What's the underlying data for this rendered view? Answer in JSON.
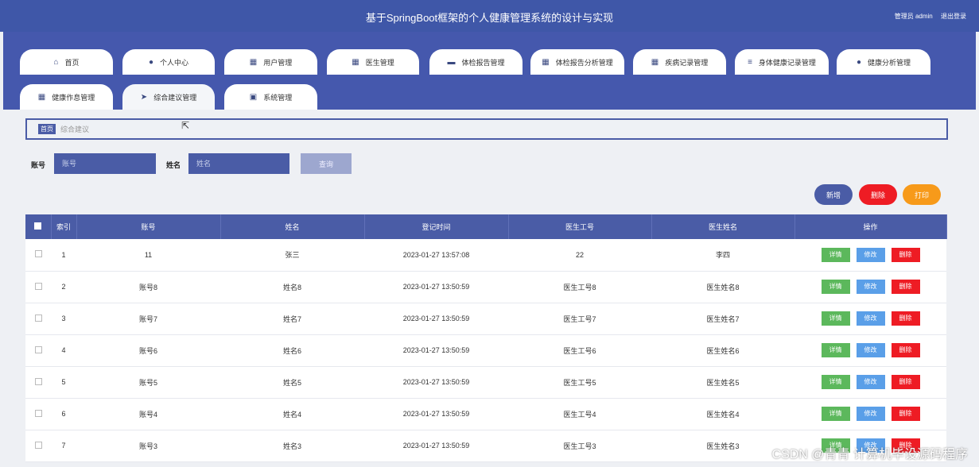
{
  "header": {
    "title": "基于SpringBoot框架的个人健康管理系统的设计与实现",
    "user_label": "管理员 admin",
    "logout_label": "退出登录"
  },
  "nav": {
    "tabs": [
      {
        "label": "首页",
        "icon": "home-icon",
        "glyph": "⌂"
      },
      {
        "label": "个人中心",
        "icon": "user-icon",
        "glyph": "●"
      },
      {
        "label": "用户管理",
        "icon": "grid-icon",
        "glyph": "▦"
      },
      {
        "label": "医生管理",
        "icon": "grid-icon",
        "glyph": "▦"
      },
      {
        "label": "体检报告管理",
        "icon": "briefcase-icon",
        "glyph": "▬"
      },
      {
        "label": "体检报告分析管理",
        "icon": "grid-icon",
        "glyph": "▦"
      },
      {
        "label": "疾病记录管理",
        "icon": "grid-icon",
        "glyph": "▦"
      },
      {
        "label": "身体健康记录管理",
        "icon": "list-icon",
        "glyph": "≡"
      },
      {
        "label": "健康分析管理",
        "icon": "user-icon",
        "glyph": "●"
      },
      {
        "label": "健康作息管理",
        "icon": "grid-icon",
        "glyph": "▦"
      },
      {
        "label": "综合建议管理",
        "icon": "send-icon",
        "glyph": "➤"
      },
      {
        "label": "系统管理",
        "icon": "clipboard-icon",
        "glyph": "▣"
      }
    ]
  },
  "breadcrumb": {
    "home": "首页",
    "current": "综合建议"
  },
  "search": {
    "account_label": "账号",
    "account_placeholder": "账号",
    "name_label": "姓名",
    "name_placeholder": "姓名",
    "query_label": "查询"
  },
  "actions": {
    "add": "新增",
    "delete": "删除",
    "print": "打印"
  },
  "table": {
    "headers": [
      "索引",
      "账号",
      "姓名",
      "登记时间",
      "医生工号",
      "医生姓名",
      "操作"
    ],
    "op_labels": {
      "detail": "详情",
      "edit": "修改",
      "delete": "删除"
    },
    "rows": [
      [
        "1",
        "11",
        "张三",
        "2023-01-27 13:57:08",
        "22",
        "李四"
      ],
      [
        "2",
        "账号8",
        "姓名8",
        "2023-01-27 13:50:59",
        "医生工号8",
        "医生姓名8"
      ],
      [
        "3",
        "账号7",
        "姓名7",
        "2023-01-27 13:50:59",
        "医生工号7",
        "医生姓名7"
      ],
      [
        "4",
        "账号6",
        "姓名6",
        "2023-01-27 13:50:59",
        "医生工号6",
        "医生姓名6"
      ],
      [
        "5",
        "账号5",
        "姓名5",
        "2023-01-27 13:50:59",
        "医生工号5",
        "医生姓名5"
      ],
      [
        "6",
        "账号4",
        "姓名4",
        "2023-01-27 13:50:59",
        "医生工号4",
        "医生姓名4"
      ],
      [
        "7",
        "账号3",
        "姓名3",
        "2023-01-27 13:50:59",
        "医生工号3",
        "医生姓名3"
      ]
    ]
  },
  "watermark": "CSDN @青青 计算机毕设源码程序",
  "colors": {
    "primary": "#4a5ca6",
    "header": "#3f57a8",
    "danger": "#ee1c24",
    "warning": "#f79a1a",
    "success": "#5cb85c",
    "info": "#5a9fe8"
  }
}
